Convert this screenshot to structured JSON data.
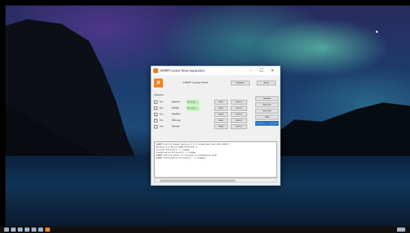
{
  "window": {
    "title": "XAMPP Control Panel Application",
    "controls": {
      "minimize": "–",
      "maximize": "☐",
      "close": "✕"
    }
  },
  "header": {
    "logo_text": "X",
    "title": "XAMPP Control Panel",
    "netstat_button": "Netstat",
    "shell_button": "Shell"
  },
  "modules_label": "Modules",
  "modules": [
    {
      "service": "Svc",
      "name": "Apache",
      "pid": "Running",
      "running": true,
      "action1": "Stop",
      "action2": "Admin"
    },
    {
      "service": "Svc",
      "name": "MySQL",
      "pid": "Running",
      "running": true,
      "action1": "Stop",
      "action2": "Admin"
    },
    {
      "service": "Svc",
      "name": "FileZilla",
      "pid": "",
      "running": false,
      "action1": "Start",
      "action2": "Admin"
    },
    {
      "service": "Svc",
      "name": "Mercury",
      "pid": "",
      "running": false,
      "action1": "Start",
      "action2": "Admin"
    },
    {
      "service": "Svc",
      "name": "Tomcat",
      "pid": "",
      "running": false,
      "action1": "Start",
      "action2": "Admin"
    }
  ],
  "side_buttons": [
    "Netstat",
    "Explorer",
    "Services",
    "Help",
    "Quit"
  ],
  "log_lines": [
    "XAMPP Control Panel Version 3.2.2 [Compiled: Nov 12th 2015 ]",
    "Windows 6.2 Build 9200 Platform 2",
    "Current Directory: C:\\xampp",
    "Installation Directory: C:\\xampp",
    "XAMPP Control Panel is running in standalone mode",
    "XAMPP Installation Directory: \"c:\\xampp\\\""
  ],
  "colors": {
    "accent": "#f5821f",
    "running_bg": "#b8f0b0",
    "quit_button": "#3c7fd0"
  }
}
